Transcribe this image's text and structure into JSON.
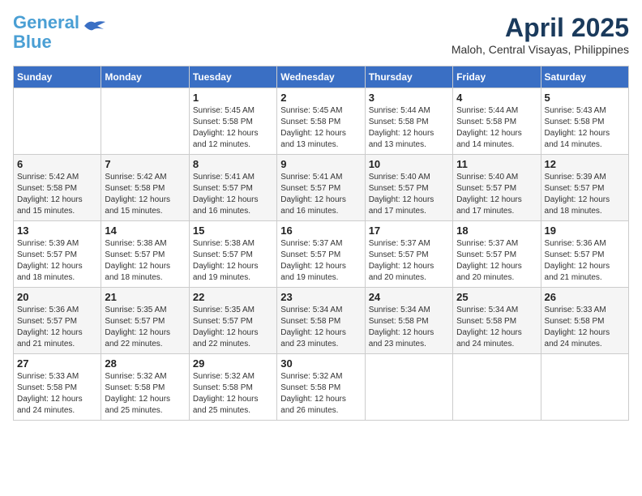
{
  "header": {
    "logo_line1": "General",
    "logo_line2": "Blue",
    "month_title": "April 2025",
    "location": "Maloh, Central Visayas, Philippines"
  },
  "weekdays": [
    "Sunday",
    "Monday",
    "Tuesday",
    "Wednesday",
    "Thursday",
    "Friday",
    "Saturday"
  ],
  "weeks": [
    [
      {
        "day": "",
        "info": ""
      },
      {
        "day": "",
        "info": ""
      },
      {
        "day": "1",
        "info": "Sunrise: 5:45 AM\nSunset: 5:58 PM\nDaylight: 12 hours\nand 12 minutes."
      },
      {
        "day": "2",
        "info": "Sunrise: 5:45 AM\nSunset: 5:58 PM\nDaylight: 12 hours\nand 13 minutes."
      },
      {
        "day": "3",
        "info": "Sunrise: 5:44 AM\nSunset: 5:58 PM\nDaylight: 12 hours\nand 13 minutes."
      },
      {
        "day": "4",
        "info": "Sunrise: 5:44 AM\nSunset: 5:58 PM\nDaylight: 12 hours\nand 14 minutes."
      },
      {
        "day": "5",
        "info": "Sunrise: 5:43 AM\nSunset: 5:58 PM\nDaylight: 12 hours\nand 14 minutes."
      }
    ],
    [
      {
        "day": "6",
        "info": "Sunrise: 5:42 AM\nSunset: 5:58 PM\nDaylight: 12 hours\nand 15 minutes."
      },
      {
        "day": "7",
        "info": "Sunrise: 5:42 AM\nSunset: 5:58 PM\nDaylight: 12 hours\nand 15 minutes."
      },
      {
        "day": "8",
        "info": "Sunrise: 5:41 AM\nSunset: 5:57 PM\nDaylight: 12 hours\nand 16 minutes."
      },
      {
        "day": "9",
        "info": "Sunrise: 5:41 AM\nSunset: 5:57 PM\nDaylight: 12 hours\nand 16 minutes."
      },
      {
        "day": "10",
        "info": "Sunrise: 5:40 AM\nSunset: 5:57 PM\nDaylight: 12 hours\nand 17 minutes."
      },
      {
        "day": "11",
        "info": "Sunrise: 5:40 AM\nSunset: 5:57 PM\nDaylight: 12 hours\nand 17 minutes."
      },
      {
        "day": "12",
        "info": "Sunrise: 5:39 AM\nSunset: 5:57 PM\nDaylight: 12 hours\nand 18 minutes."
      }
    ],
    [
      {
        "day": "13",
        "info": "Sunrise: 5:39 AM\nSunset: 5:57 PM\nDaylight: 12 hours\nand 18 minutes."
      },
      {
        "day": "14",
        "info": "Sunrise: 5:38 AM\nSunset: 5:57 PM\nDaylight: 12 hours\nand 18 minutes."
      },
      {
        "day": "15",
        "info": "Sunrise: 5:38 AM\nSunset: 5:57 PM\nDaylight: 12 hours\nand 19 minutes."
      },
      {
        "day": "16",
        "info": "Sunrise: 5:37 AM\nSunset: 5:57 PM\nDaylight: 12 hours\nand 19 minutes."
      },
      {
        "day": "17",
        "info": "Sunrise: 5:37 AM\nSunset: 5:57 PM\nDaylight: 12 hours\nand 20 minutes."
      },
      {
        "day": "18",
        "info": "Sunrise: 5:37 AM\nSunset: 5:57 PM\nDaylight: 12 hours\nand 20 minutes."
      },
      {
        "day": "19",
        "info": "Sunrise: 5:36 AM\nSunset: 5:57 PM\nDaylight: 12 hours\nand 21 minutes."
      }
    ],
    [
      {
        "day": "20",
        "info": "Sunrise: 5:36 AM\nSunset: 5:57 PM\nDaylight: 12 hours\nand 21 minutes."
      },
      {
        "day": "21",
        "info": "Sunrise: 5:35 AM\nSunset: 5:57 PM\nDaylight: 12 hours\nand 22 minutes."
      },
      {
        "day": "22",
        "info": "Sunrise: 5:35 AM\nSunset: 5:57 PM\nDaylight: 12 hours\nand 22 minutes."
      },
      {
        "day": "23",
        "info": "Sunrise: 5:34 AM\nSunset: 5:58 PM\nDaylight: 12 hours\nand 23 minutes."
      },
      {
        "day": "24",
        "info": "Sunrise: 5:34 AM\nSunset: 5:58 PM\nDaylight: 12 hours\nand 23 minutes."
      },
      {
        "day": "25",
        "info": "Sunrise: 5:34 AM\nSunset: 5:58 PM\nDaylight: 12 hours\nand 24 minutes."
      },
      {
        "day": "26",
        "info": "Sunrise: 5:33 AM\nSunset: 5:58 PM\nDaylight: 12 hours\nand 24 minutes."
      }
    ],
    [
      {
        "day": "27",
        "info": "Sunrise: 5:33 AM\nSunset: 5:58 PM\nDaylight: 12 hours\nand 24 minutes."
      },
      {
        "day": "28",
        "info": "Sunrise: 5:32 AM\nSunset: 5:58 PM\nDaylight: 12 hours\nand 25 minutes."
      },
      {
        "day": "29",
        "info": "Sunrise: 5:32 AM\nSunset: 5:58 PM\nDaylight: 12 hours\nand 25 minutes."
      },
      {
        "day": "30",
        "info": "Sunrise: 5:32 AM\nSunset: 5:58 PM\nDaylight: 12 hours\nand 26 minutes."
      },
      {
        "day": "",
        "info": ""
      },
      {
        "day": "",
        "info": ""
      },
      {
        "day": "",
        "info": ""
      }
    ]
  ]
}
